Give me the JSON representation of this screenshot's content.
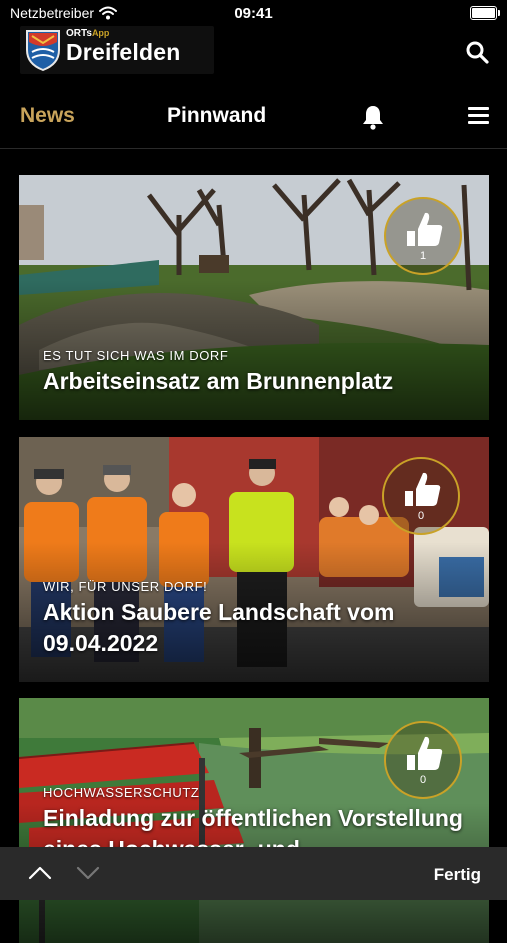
{
  "status_bar": {
    "carrier": "Netzbetreiber",
    "time": "09:41",
    "battery_level": 1.0
  },
  "header": {
    "logo_small": "ORTs",
    "logo_app": "App",
    "logo_title": "Dreifelden"
  },
  "nav": {
    "tabs": [
      {
        "label": "News",
        "active": true
      },
      {
        "label": "Pinnwand",
        "active": false
      }
    ]
  },
  "feed": {
    "cards": [
      {
        "category": "ES TUT SICH WAS IM DORF",
        "title": "Arbeitseinsatz am Brunnenplatz",
        "likes": "1"
      },
      {
        "category": "WIR, FÜR UNSER DORF!",
        "title": "Aktion Saubere Landschaft vom 09.04.2022",
        "likes": "0"
      },
      {
        "category": "HOCHWASSERSCHUTZ",
        "title": "Einladung zur öffentlichen Vorstellung eines Hochwasser- und",
        "likes": "0"
      }
    ]
  },
  "toolbar": {
    "done_label": "Fertig"
  },
  "colors": {
    "accent": "#c9a227",
    "active_tab": "#c9a45b",
    "background": "#000000",
    "toolbar": "#2a2a2a"
  }
}
